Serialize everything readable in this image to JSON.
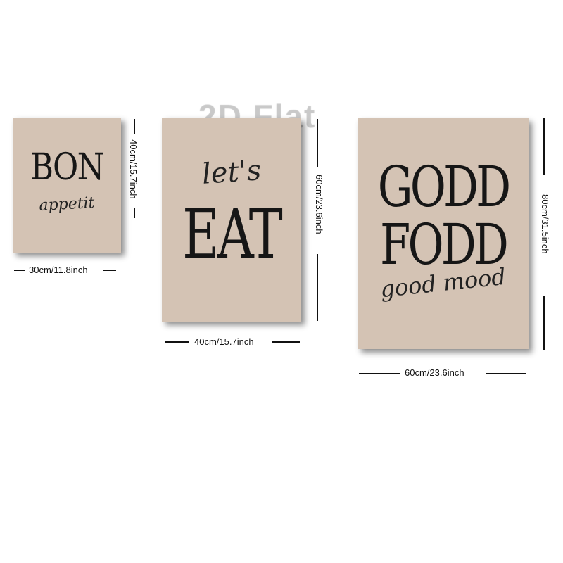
{
  "watermark": "2D Flat",
  "posters": [
    {
      "title": "BON",
      "script": "appetit",
      "width_label": "30cm/11.8inch",
      "height_label": "40cm/15.7inch"
    },
    {
      "script": "let's",
      "title": "EAT",
      "width_label": "40cm/15.7inch",
      "height_label": "60cm/23.6inch"
    },
    {
      "line1": "GODD",
      "line2": "FODD",
      "script": "good mood",
      "width_label": "60cm/23.6inch",
      "height_label": "80cm/31.5inch"
    }
  ],
  "colors": {
    "poster_background": "#d4c3b4",
    "text": "#161616"
  }
}
